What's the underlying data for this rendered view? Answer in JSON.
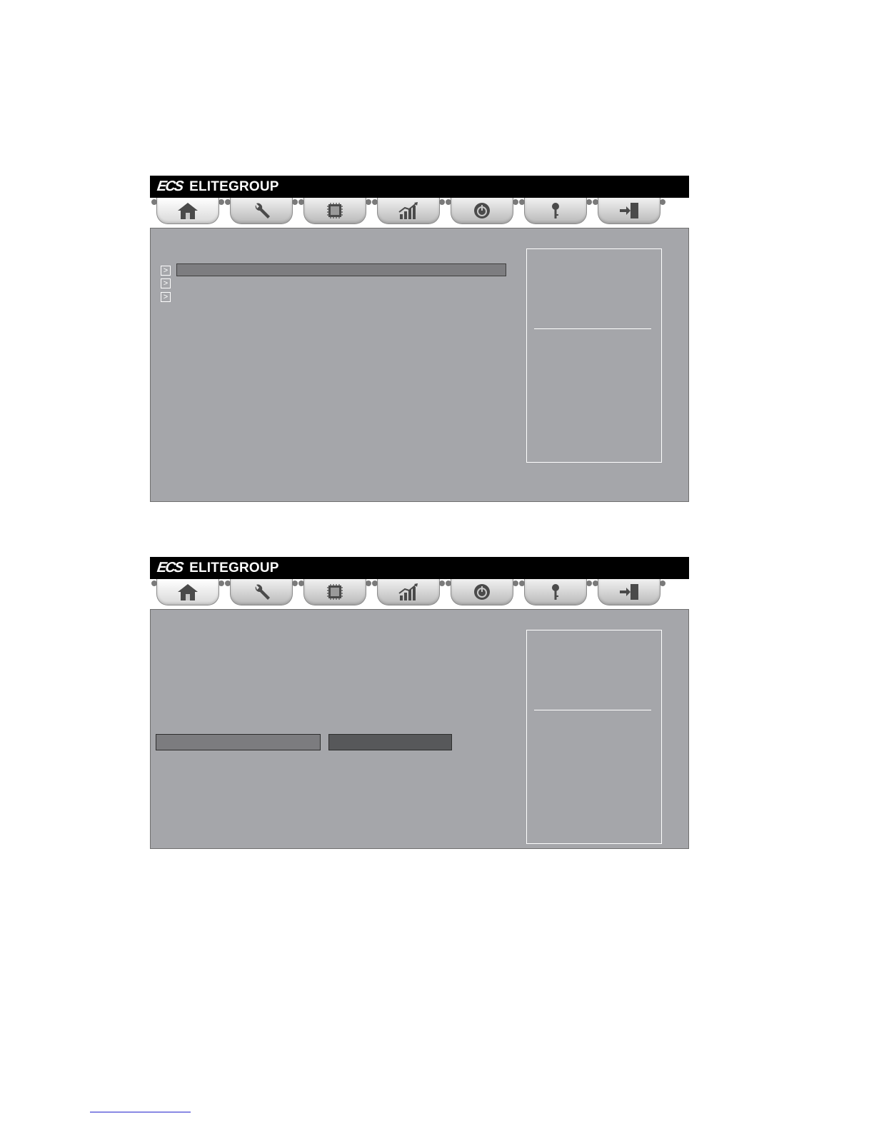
{
  "brand": {
    "logo": "ECS",
    "name": "ELITEGROUP"
  },
  "tabs": [
    {
      "icon": "home-icon"
    },
    {
      "icon": "wrench-icon"
    },
    {
      "icon": "chip-icon"
    },
    {
      "icon": "performance-chart-icon"
    },
    {
      "icon": "power-icon"
    },
    {
      "icon": "key-icon"
    },
    {
      "icon": "exit-icon"
    }
  ],
  "screen1": {
    "menu_items": [
      {
        "arrow": ">",
        "label": "",
        "selected": true
      },
      {
        "arrow": ">",
        "label": "",
        "selected": false
      },
      {
        "arrow": ">",
        "label": "",
        "selected": false
      }
    ]
  },
  "screen2": {
    "field_label": "",
    "field_value": ""
  },
  "colors": {
    "brand_bar": "#000000",
    "panel": "#a5a6aa",
    "highlight": "#7d7d80",
    "field_value": "#57585a"
  }
}
